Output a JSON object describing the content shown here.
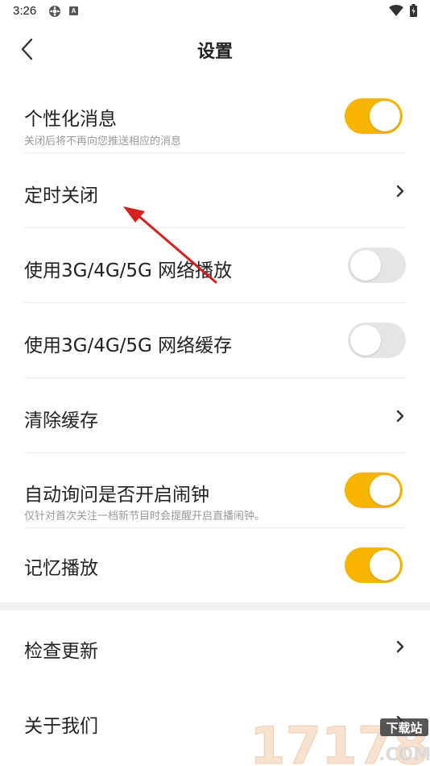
{
  "status_bar": {
    "time": "3:26",
    "icons": [
      "settings-status-icon",
      "a-status-icon",
      "wifi-icon",
      "battery-icon"
    ]
  },
  "header": {
    "title": "设置",
    "back_icon": "back-arrow-icon"
  },
  "settings": [
    {
      "label": "个性化消息",
      "sublabel": "关闭后将不再向您推送相应的消息",
      "control": "toggle",
      "on": true
    },
    {
      "label": "定时关闭",
      "control": "chevron"
    },
    {
      "label": "使用3G/4G/5G 网络播放",
      "control": "toggle",
      "on": false
    },
    {
      "label": "使用3G/4G/5G 网络缓存",
      "control": "toggle",
      "on": false
    },
    {
      "label": "清除缓存",
      "control": "chevron"
    },
    {
      "label": "自动询问是否开启闹钟",
      "sublabel": "仅针对首次关注一档新节目时会提醒开启直播闹钟。",
      "control": "toggle",
      "on": true
    },
    {
      "label": "记忆播放",
      "control": "toggle",
      "on": true
    }
  ],
  "settings_bottom": [
    {
      "label": "检查更新",
      "control": "chevron"
    },
    {
      "label": "关于我们",
      "control": "chevron"
    }
  ],
  "watermark": {
    "number": "17178",
    "tag": "下载站",
    "domain": ".COM"
  },
  "colors": {
    "toggle_on": "#f7b400",
    "toggle_off": "#e5e5e5",
    "annotation_arrow": "#d61f1f"
  }
}
